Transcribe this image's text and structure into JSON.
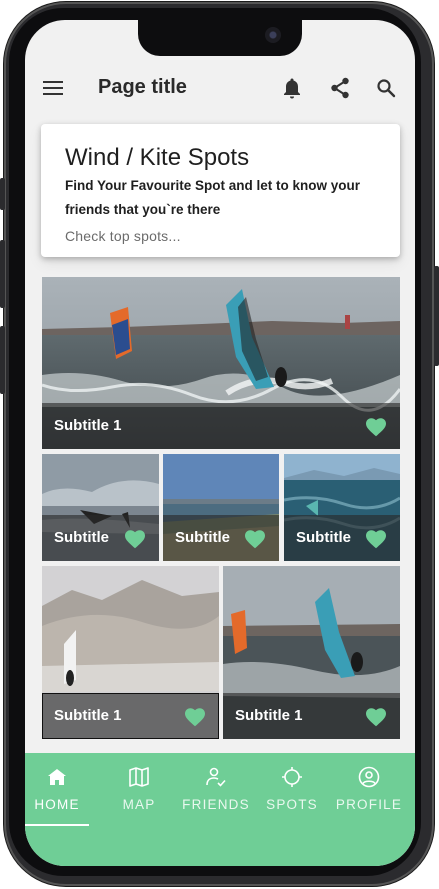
{
  "app": {
    "page_title": "Page title"
  },
  "header_card": {
    "title": "Wind / Kite Spots",
    "subtitle": "Find Your Favourite Spot and let to know your friends that you`re there",
    "hint": "Check top spots..."
  },
  "tiles": [
    {
      "label": "Subtitle 1",
      "favorited": true
    },
    {
      "label": "Subtitle",
      "favorited": true
    },
    {
      "label": "Subtitle",
      "favorited": true
    },
    {
      "label": "Subtitle",
      "favorited": true
    },
    {
      "label": "Subtitle 1",
      "favorited": true
    },
    {
      "label": "Subtitle 1",
      "favorited": true
    }
  ],
  "bottom_nav": {
    "items": [
      {
        "label": "HOME",
        "icon": "home-icon",
        "active": true
      },
      {
        "label": "MAP",
        "icon": "map-icon",
        "active": false
      },
      {
        "label": "FRIENDS",
        "icon": "friends-icon",
        "active": false
      },
      {
        "label": "SPOTS",
        "icon": "spots-icon",
        "active": false
      },
      {
        "label": "PROFILE",
        "icon": "profile-icon",
        "active": false
      }
    ]
  },
  "icons": {
    "menu": "menu-icon",
    "notifications": "bell-icon",
    "share": "share-icon",
    "search": "search-icon",
    "favorite": "heart-icon"
  },
  "colors": {
    "accent": "#6fce96",
    "heart": "#6fce96",
    "background": "#f1f1f1"
  }
}
